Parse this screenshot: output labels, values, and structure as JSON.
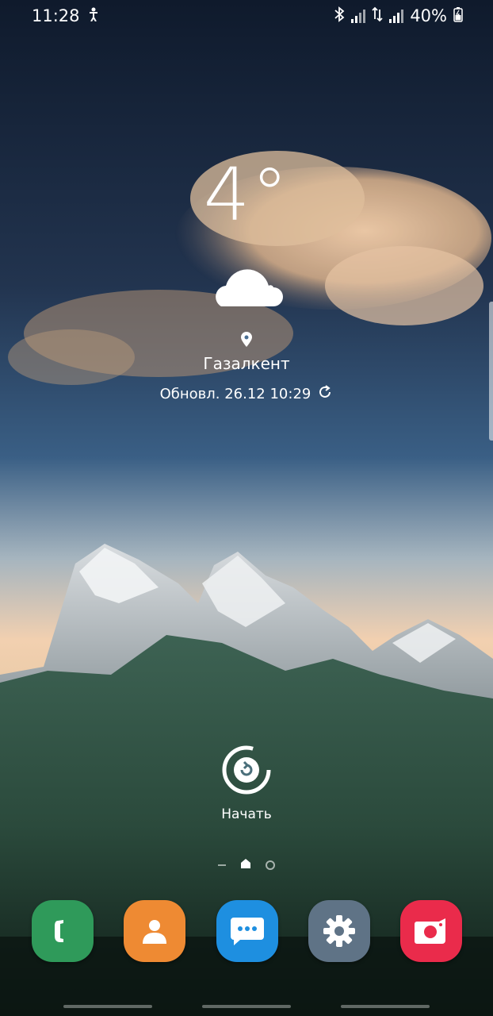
{
  "status": {
    "time": "11:28",
    "battery": "40%"
  },
  "weather": {
    "temperature": "4°",
    "location": "Газалкент",
    "updated": "Обновл. 26.12 10:29"
  },
  "bixby": {
    "label": "Начать"
  },
  "dock": [
    {
      "name": "Phone",
      "color": "#2f9a5a"
    },
    {
      "name": "Contacts",
      "color": "#ee8a33"
    },
    {
      "name": "Messages",
      "color": "#1e8fe0"
    },
    {
      "name": "Settings",
      "color": "#5f7386"
    },
    {
      "name": "Camera",
      "color": "#ea2b4b"
    }
  ],
  "colors": {
    "sky_top": "#0f1a2c",
    "sky_mid": "#3a5f85",
    "horizon": "#f2d0b0",
    "forest": "#2f4d3f"
  }
}
